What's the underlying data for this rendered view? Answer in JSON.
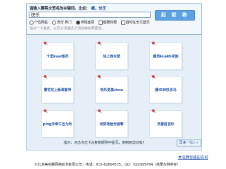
{
  "header": {
    "prompt": "请输入要英文签名的关键词，比如：",
    "example": "橘，快乐",
    "search_value": "快乐",
    "generate_label": "起 昵 称"
  },
  "options": [
    {
      "label": "个性网名",
      "type": "radio",
      "checked": false
    },
    {
      "label": "流行·热门",
      "type": "radio",
      "checked": false
    },
    {
      "label": "诗情画意",
      "type": "radio",
      "checked": true
    },
    {
      "label": "超酷炫酷",
      "type": "check",
      "checked": false
    },
    {
      "label": "自动在长文显交",
      "type": "check",
      "checked": true
    }
  ],
  "tip": "请对一下复查，以同义词或近义词替换效果更佳。",
  "notes": [
    {
      "label": "千里kuai落风"
    },
    {
      "label": "快上西木梁"
    },
    {
      "label": "飘然kuai8i花韵"
    },
    {
      "label": "樱花花上新滴香萍"
    },
    {
      "label": "快乐变高chou"
    },
    {
      "label": "娜IOIIl快乐马"
    },
    {
      "label": "ping手牵牛丑为乐"
    },
    {
      "label": "河阳地娃无音擎"
    },
    {
      "label": "灵都首首乐"
    }
  ],
  "footer": {
    "hint": "提示：点击点击卡片复制昵称中首页，复制到剪切板！",
    "next_label": "再来一批>>",
    "brand": "美名腾智能起名网",
    "copyright": "©北京美名腾网络技术有限公司，电话：010-82894575，QQ：622005784（结果仅供参考）"
  },
  "colors": {
    "accent": "#5aa2e3",
    "note_text": "#1c4fa6",
    "pin": "#d9443b"
  }
}
